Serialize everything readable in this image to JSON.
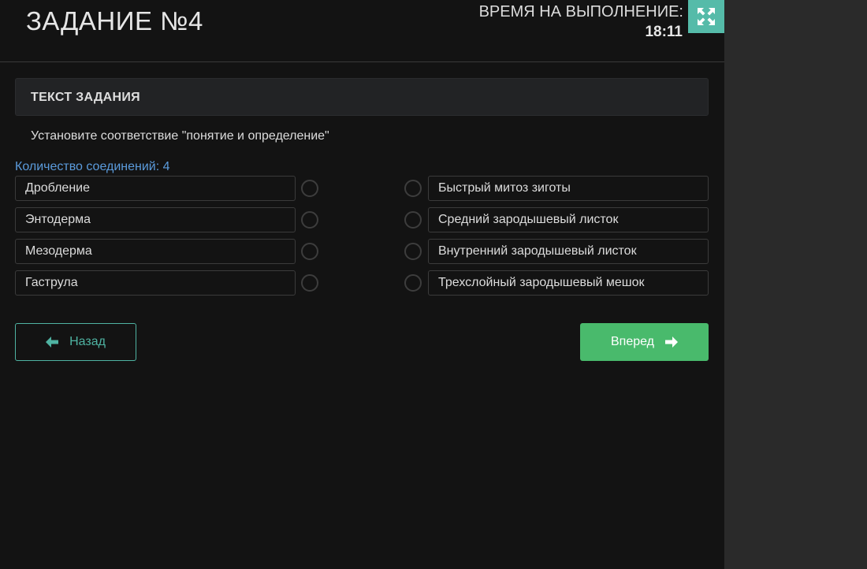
{
  "header": {
    "task_title": "ЗАДАНИЕ №4",
    "timer_label": "ВРЕМЯ НА ВЫПОЛНЕНИЕ:",
    "timer_value": "18:11",
    "fullscreen_icon": "expand-icon"
  },
  "task": {
    "section_title": "ТЕКСТ ЗАДАНИЯ",
    "question": "Установите соответствие \"понятие и определение\"",
    "connections_label": "Количество соединений: 4"
  },
  "left_items": [
    {
      "label": "Дробление"
    },
    {
      "label": "Энтодерма"
    },
    {
      "label": "Мезодерма"
    },
    {
      "label": "Гаструла"
    }
  ],
  "right_items": [
    {
      "label": "Быстрый митоз зиготы"
    },
    {
      "label": "Средний зародышевый листок"
    },
    {
      "label": "Внутренний зародышевый листок"
    },
    {
      "label": "Трехслойный зародышевый мешок"
    }
  ],
  "nav": {
    "back_label": "Назад",
    "next_label": "Вперед",
    "back_icon": "arrow-left-icon",
    "next_icon": "arrow-right-icon"
  },
  "colors": {
    "accent": "#55bba9",
    "next_button": "#49ba6c",
    "connections_text": "#5b9bdc"
  }
}
